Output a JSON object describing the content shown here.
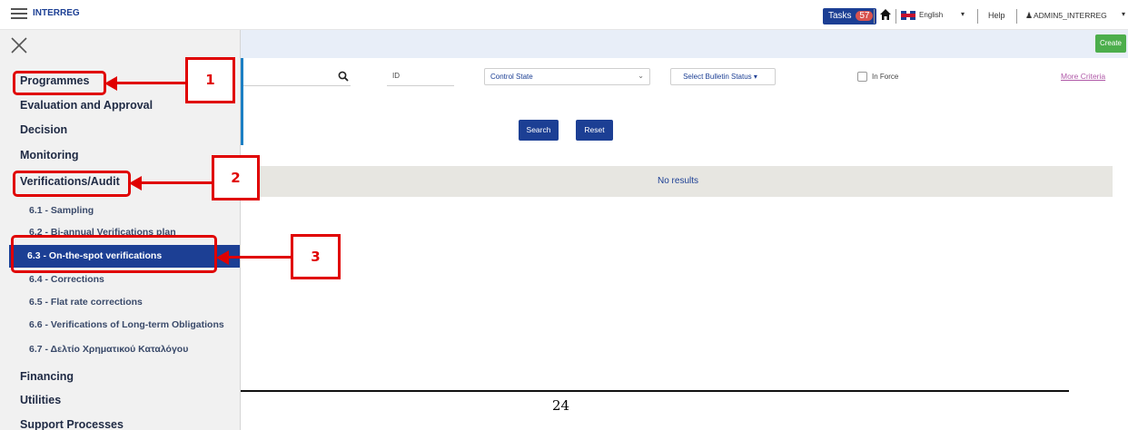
{
  "header": {
    "brand": "INTERREG",
    "tasks_label": "Tasks",
    "tasks_count": "57",
    "language": "English",
    "help": "Help",
    "user": "ADMIN5_INTERREG",
    "icons": [
      "menu-icon",
      "home-icon",
      "uk-flag-icon",
      "user-icon"
    ]
  },
  "toolbar": {
    "create_label": "Create"
  },
  "filters": {
    "id_label": "ID",
    "control_state": "Control State",
    "bulletin_status": "Select Bulletin Status ▾",
    "in_force_label": "In Force",
    "more_criteria": "More Criteria",
    "search_button": "Search",
    "reset_button": "Reset"
  },
  "results": {
    "empty_text": "No results"
  },
  "sidebar": {
    "items": [
      {
        "label": "Programmes"
      },
      {
        "label": "Evaluation and Approval"
      },
      {
        "label": "Decision"
      },
      {
        "label": "Monitoring"
      },
      {
        "label": "Verifications/Audit"
      }
    ],
    "subitems": [
      {
        "label": "6.1 - Sampling"
      },
      {
        "label": "6.2 - Bi-annual Verifications plan"
      },
      {
        "label": "6.3 - On-the-spot verifications"
      },
      {
        "label": "6.4 - Corrections"
      },
      {
        "label": "6.5 - Flat rate corrections"
      },
      {
        "label": "6.6 - Verifications of Long-term Obligations"
      },
      {
        "label": "6.7 - Δελτίο Χρηματικού Καταλόγου"
      }
    ],
    "bottom_items": [
      {
        "label": "Financing"
      },
      {
        "label": "Utilities"
      },
      {
        "label": "Support Processes"
      }
    ]
  },
  "callouts": [
    "1",
    "2",
    "3"
  ],
  "page_number": "24",
  "colors": {
    "primary": "#1c3f94",
    "accent_red": "#e00000",
    "create_green": "#4cae4c",
    "tasks_badge": "#d9534f"
  }
}
